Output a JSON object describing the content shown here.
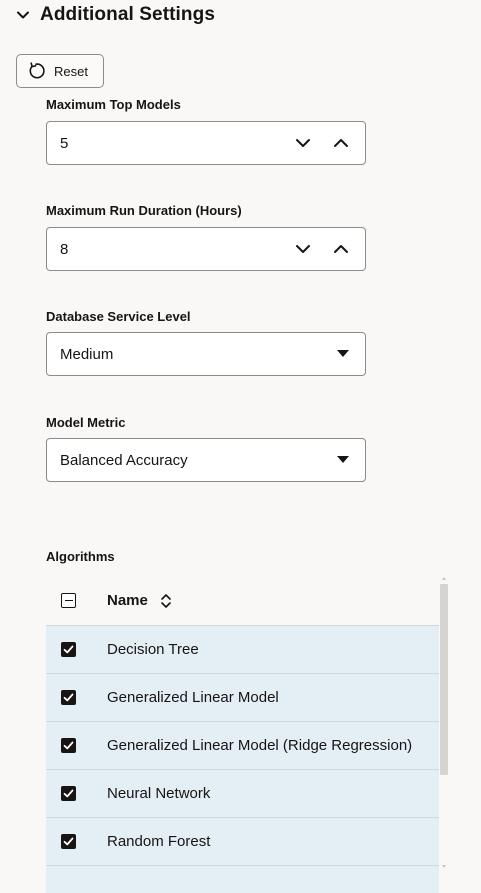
{
  "section": {
    "title": "Additional Settings",
    "icon": "chevron-down-icon"
  },
  "reset": {
    "label": "Reset",
    "icon": "reset-icon"
  },
  "fields": {
    "max_top_models": {
      "label": "Maximum Top Models",
      "value": "5"
    },
    "max_run_duration": {
      "label": "Maximum Run Duration (Hours)",
      "value": "8"
    },
    "service_level": {
      "label": "Database Service Level",
      "value": "Medium"
    },
    "model_metric": {
      "label": "Model Metric",
      "value": "Balanced Accuracy"
    }
  },
  "algorithms": {
    "label": "Algorithms",
    "header": {
      "name": "Name",
      "sort_icon": "sort-icon"
    },
    "rows": [
      {
        "name": "Decision Tree",
        "checked": true
      },
      {
        "name": "Generalized Linear Model",
        "checked": true
      },
      {
        "name": "Generalized Linear Model (Ridge Regression)",
        "checked": true
      },
      {
        "name": "Neural Network",
        "checked": true
      },
      {
        "name": "Random Forest",
        "checked": true
      }
    ]
  },
  "colors": {
    "row_selected": "#e4eff5",
    "text": "#161513",
    "background": "#f9f8f6"
  }
}
